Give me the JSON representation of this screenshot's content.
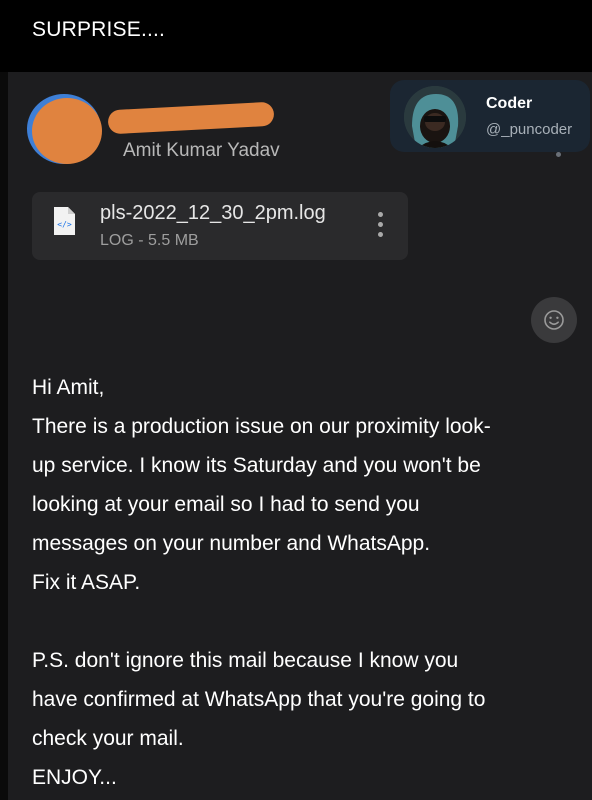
{
  "subject": "SURPRISE....",
  "sender": {
    "name": "Amit Kumar Yadav"
  },
  "watermark": {
    "name": "Coder",
    "handle": "@_puncoder"
  },
  "attachment": {
    "icon": "code-file-icon",
    "filename": "pls-2022_12_30_2pm.log",
    "meta": "LOG - 5.5 MB"
  },
  "icons": {
    "menu": "more-vert-icon",
    "reaction": "emoji-smile-icon"
  },
  "colors": {
    "background": "#1d1d1f",
    "redaction": "#e0833f",
    "text": "#ffffff",
    "muted": "#b8b8b8"
  },
  "body": {
    "lines": [
      "Hi Amit,",
      "There is a production issue on our proximity look-",
      "up service. I know its Saturday and you won't be",
      "looking at your email so I had to send you",
      "messages on your number and WhatsApp.",
      "Fix it ASAP.",
      "P.S. don't ignore this mail because I know you",
      "have confirmed at WhatsApp that you're going to",
      "check your mail.",
      "ENJOY..."
    ]
  }
}
